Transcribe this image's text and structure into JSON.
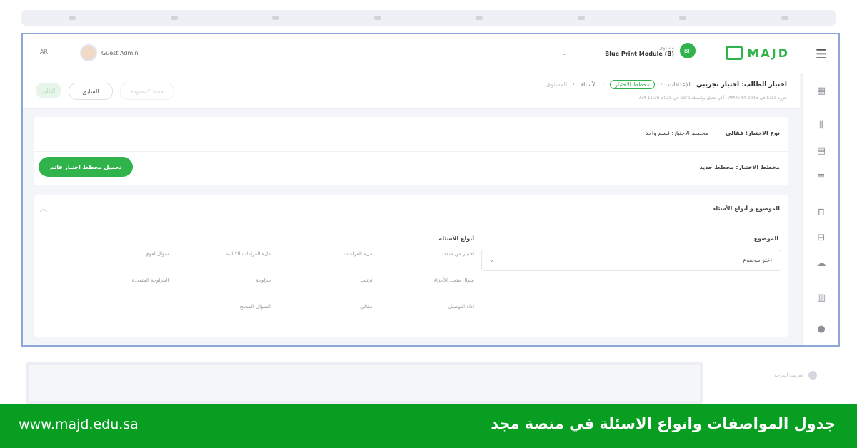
{
  "header": {
    "logo_text": "MAJD",
    "user_role": "مستوى",
    "user_level": "Blue Print Module (B)",
    "user_initials": "BP",
    "guest_name": "Guest Admin",
    "lang": "AR"
  },
  "breadcrumb": {
    "title": "اختبار الطالب: اختبار تجريبي",
    "steps": [
      "الإعدادات",
      "مخطط الاختبار",
      "الأسئلة",
      "المستوى"
    ],
    "subline": "حرره Sara في 2025 9:44 AM · آخر تعديل بواسطة Sara في 2025 11:36 AM"
  },
  "actions": {
    "save": "حفظ كمسودة",
    "previous": "السابق",
    "next": "التالي"
  },
  "plan": {
    "type_label": "نوع الاختبار: فقالي",
    "type_value": "مخطط الاختبار: قسم واحد",
    "new_plan_label": "مخطط الاختبار: مخطط جديد",
    "load_button": "تحميل مخطط اختبار قائم"
  },
  "section": {
    "title": "الموضوع و أنواع الأسئلة",
    "subject_label": "الموضوع",
    "subject_placeholder": "اختر موضوع",
    "question_types_label": "أنواع الأسئلة",
    "question_types": [
      "اختيار من متعدد",
      "ملء الفراغات",
      "ملء الفراغات الكتابية",
      "سؤال لغوي",
      "سؤال متعدد الأجزاء",
      "ترتيب",
      "مزاوجة",
      "المزاوجة المتعددة",
      "أداة التوصيل",
      "مقالي",
      "السؤال المدمج",
      ""
    ]
  },
  "bottom": {
    "label": "تعريف الدرجة"
  },
  "footer": {
    "url": "www.majd.edu.sa",
    "caption": "جدول المواصفات وانواع الاسئلة في منصة مجد"
  },
  "colors": {
    "brand_green": "#2fb34a",
    "footer_green": "#079e22",
    "frame_border": "#8fa6d8"
  },
  "icons": {
    "menu": "hamburger-icon",
    "dashboard": "dashboard-icon",
    "library": "library-icon",
    "document": "document-icon",
    "list": "list-icon",
    "lock": "lock-icon",
    "print": "printer-icon",
    "cloud": "cloud-icon",
    "chart": "bar-chart-icon",
    "user": "user-icon"
  }
}
